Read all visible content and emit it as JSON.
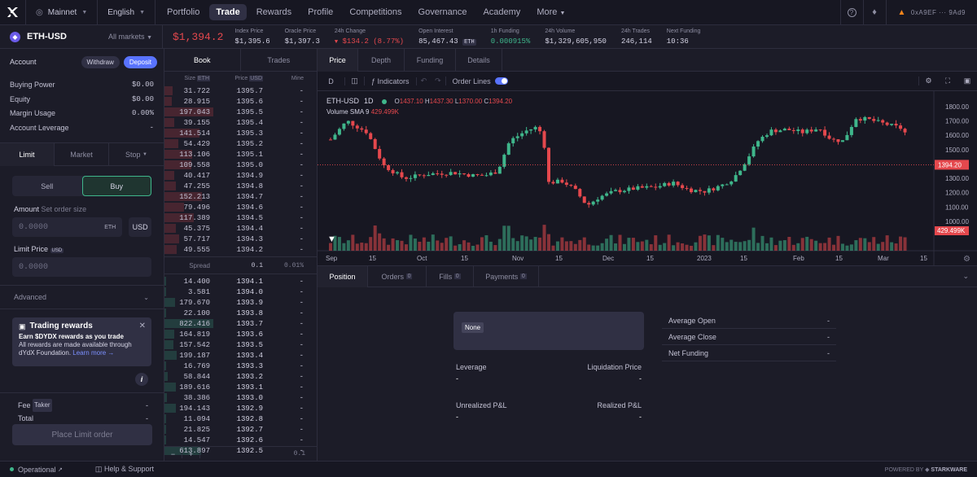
{
  "nav": {
    "network": "Mainnet",
    "language": "English",
    "links": [
      "Portfolio",
      "Trade",
      "Rewards",
      "Profile",
      "Competitions",
      "Governance",
      "Academy"
    ],
    "more": "More",
    "wallet": "0xA9EF ··· 9Ad9"
  },
  "market": {
    "symbol": "ETH-USD",
    "all_markets": "All markets",
    "price": "$1,394.2",
    "stats": [
      {
        "label": "Index Price",
        "value": "$1,395.6"
      },
      {
        "label": "Oracle Price",
        "value": "$1,397.3"
      },
      {
        "label": "24h Change",
        "value": "$134.2 (8.77%)"
      },
      {
        "label": "Open Interest",
        "value": "85,467.43",
        "badge": "ETH"
      },
      {
        "label": "1h Funding",
        "value": "0.000915%"
      },
      {
        "label": "24h Volume",
        "value": "$1,329,605,950"
      },
      {
        "label": "24h Trades",
        "value": "246,114"
      },
      {
        "label": "Next Funding",
        "value": "10:36"
      }
    ]
  },
  "account": {
    "title": "Account",
    "withdraw": "Withdraw",
    "deposit": "Deposit",
    "rows": [
      {
        "label": "Buying Power",
        "value": "$0.00"
      },
      {
        "label": "Equity",
        "value": "$0.00"
      },
      {
        "label": "Margin Usage",
        "value": "0.00%"
      },
      {
        "label": "Account Leverage",
        "value": "-"
      }
    ]
  },
  "order": {
    "tabs": [
      "Limit",
      "Market",
      "Stop"
    ],
    "sell": "Sell",
    "buy": "Buy",
    "amount_label": "Amount",
    "amount_hint": "Set order size",
    "amount_placeholder": "0.0000",
    "amount_unit": "ETH",
    "currency": "USD",
    "limit_label": "Limit Price",
    "limit_unit": "USD",
    "limit_placeholder": "0.0000",
    "advanced": "Advanced",
    "rewards_title": "Trading rewards",
    "rewards_bold": "Earn $DYDX rewards as you trade",
    "rewards_text": "All rewards are made available through dYdX Foundation.",
    "rewards_link": "Learn more →",
    "fee_label": "Fee",
    "fee_badge": "Taker",
    "fee_value": "-",
    "total_label": "Total",
    "total_value": "-",
    "place": "Place Limit order"
  },
  "book": {
    "tabs": [
      "Book",
      "Trades"
    ],
    "headers": {
      "size": "Size",
      "size_unit": "ETH",
      "price": "Price",
      "price_unit": "USD",
      "mine": "Mine"
    },
    "asks": [
      [
        "31.722",
        "1395.7"
      ],
      [
        "28.915",
        "1395.6"
      ],
      [
        "197.043",
        "1395.5"
      ],
      [
        "39.155",
        "1395.4"
      ],
      [
        "141.514",
        "1395.3"
      ],
      [
        "54.429",
        "1395.2"
      ],
      [
        "113.106",
        "1395.1"
      ],
      [
        "109.558",
        "1395.0"
      ],
      [
        "40.417",
        "1394.9"
      ],
      [
        "47.255",
        "1394.8"
      ],
      [
        "152.213",
        "1394.7"
      ],
      [
        "79.496",
        "1394.6"
      ],
      [
        "117.389",
        "1394.5"
      ],
      [
        "45.375",
        "1394.4"
      ],
      [
        "57.717",
        "1394.3"
      ],
      [
        "49.555",
        "1394.2"
      ]
    ],
    "spread_label": "Spread",
    "spread_value": "0.1",
    "spread_pct": "0.01%",
    "bids": [
      [
        "14.400",
        "1394.1"
      ],
      [
        "3.581",
        "1394.0"
      ],
      [
        "179.670",
        "1393.9"
      ],
      [
        "22.100",
        "1393.8"
      ],
      [
        "822.416",
        "1393.7"
      ],
      [
        "164.819",
        "1393.6"
      ],
      [
        "157.542",
        "1393.5"
      ],
      [
        "199.187",
        "1393.4"
      ],
      [
        "16.769",
        "1393.3"
      ],
      [
        "58.844",
        "1393.2"
      ],
      [
        "189.616",
        "1393.1"
      ],
      [
        "38.386",
        "1393.0"
      ],
      [
        "194.143",
        "1392.9"
      ],
      [
        "11.094",
        "1392.8"
      ],
      [
        "21.825",
        "1392.7"
      ],
      [
        "14.547",
        "1392.6"
      ],
      [
        "613.897",
        "1392.5"
      ]
    ],
    "mine": "-",
    "minus": "−",
    "plus": "+",
    "step": "0.1"
  },
  "chart": {
    "tabs": [
      "Price",
      "Depth",
      "Funding",
      "Details"
    ],
    "interval": "D",
    "indicators": "Indicators",
    "order_lines": "Order Lines",
    "legend_symbol": "ETH-USD",
    "legend_interval": "1D",
    "o": "1437.10",
    "h": "1437.30",
    "l": "1370.00",
    "c": "1394.20",
    "volume_label": "Volume SMA 9",
    "volume_value": "429.499K",
    "y_ticks": [
      "1800.00",
      "1700.00",
      "1600.00",
      "1500.00",
      "1400.00",
      "1300.00",
      "1200.00",
      "1100.00",
      "1000.00"
    ],
    "last_price": "1394.20",
    "vol_tag": "429.499K",
    "x_ticks": [
      "Sep",
      "15",
      "Oct",
      "15",
      "Nov",
      "15",
      "Dec",
      "15",
      "2023",
      "15",
      "Feb",
      "15",
      "Mar",
      "15"
    ]
  },
  "positions": {
    "tabs": [
      {
        "label": "Position"
      },
      {
        "label": "Orders",
        "count": "0"
      },
      {
        "label": "Fills",
        "count": "0"
      },
      {
        "label": "Payments",
        "count": "0"
      }
    ],
    "none": "None",
    "leverage": "Leverage",
    "leverage_v": "-",
    "liq": "Liquidation Price",
    "liq_v": "-",
    "upnl": "Unrealized P&L",
    "upnl_v": "-",
    "rpnl": "Realized P&L",
    "rpnl_v": "-",
    "right": [
      {
        "label": "Average Open",
        "value": "-"
      },
      {
        "label": "Average Close",
        "value": "-"
      },
      {
        "label": "Net Funding",
        "value": "-"
      }
    ]
  },
  "footer": {
    "status": "Operational",
    "help": "Help & Support",
    "powered": "POWERED BY",
    "brand": "STARKWARE"
  },
  "colors": {
    "green": "#3fb68b",
    "red": "#e5484d",
    "accent": "#5973fe"
  }
}
